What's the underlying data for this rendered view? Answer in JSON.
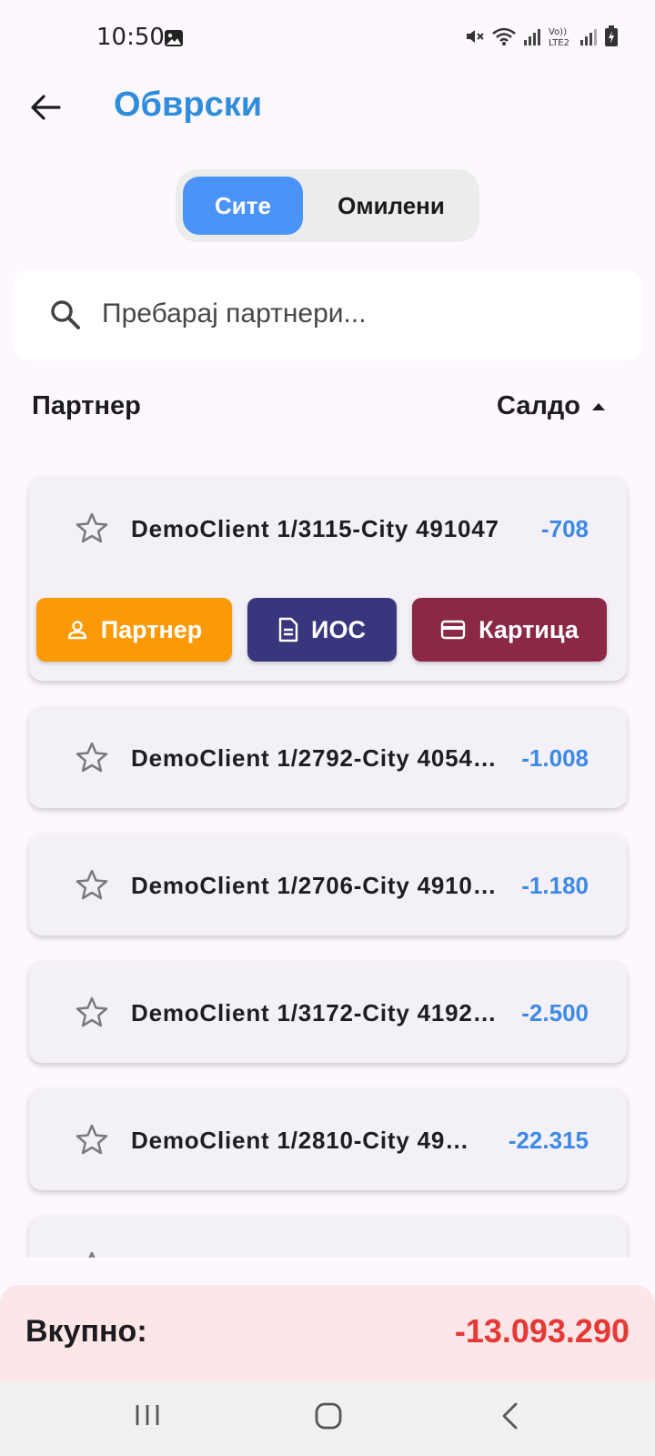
{
  "status_bar": {
    "time": "10:50"
  },
  "header": {
    "title": "Обврски"
  },
  "segment": {
    "all_label": "Сите",
    "favorites_label": "Омилени"
  },
  "search": {
    "placeholder": "Пребарај партнери..."
  },
  "columns": {
    "partner": "Партнер",
    "saldo": "Салдо"
  },
  "partners": [
    {
      "name": "DemoClient 1/3115-City 491047",
      "amount": "-708",
      "expanded": true
    },
    {
      "name": "DemoClient 1/2792-City 4054…",
      "amount": "-1.008"
    },
    {
      "name": "DemoClient 1/2706-City 4910…",
      "amount": "-1.180"
    },
    {
      "name": "DemoClient 1/3172-City 4192…",
      "amount": "-2.500"
    },
    {
      "name": "DemoClient 1/2810-City 491…",
      "amount": "-22.315"
    }
  ],
  "actions": {
    "partner_label": "Партнер",
    "ios_label": "ИОС",
    "card_label": "Картица"
  },
  "total": {
    "label": "Вкупно:",
    "value": "-13.093.290"
  },
  "colors": {
    "title": "#2f8ddc",
    "segment_active": "#4a94f7",
    "amount": "#3d8ae6",
    "partner_button": "#fb9a06",
    "ios_button": "#38367d",
    "card_button": "#8a2846",
    "total_value": "#e53935"
  }
}
